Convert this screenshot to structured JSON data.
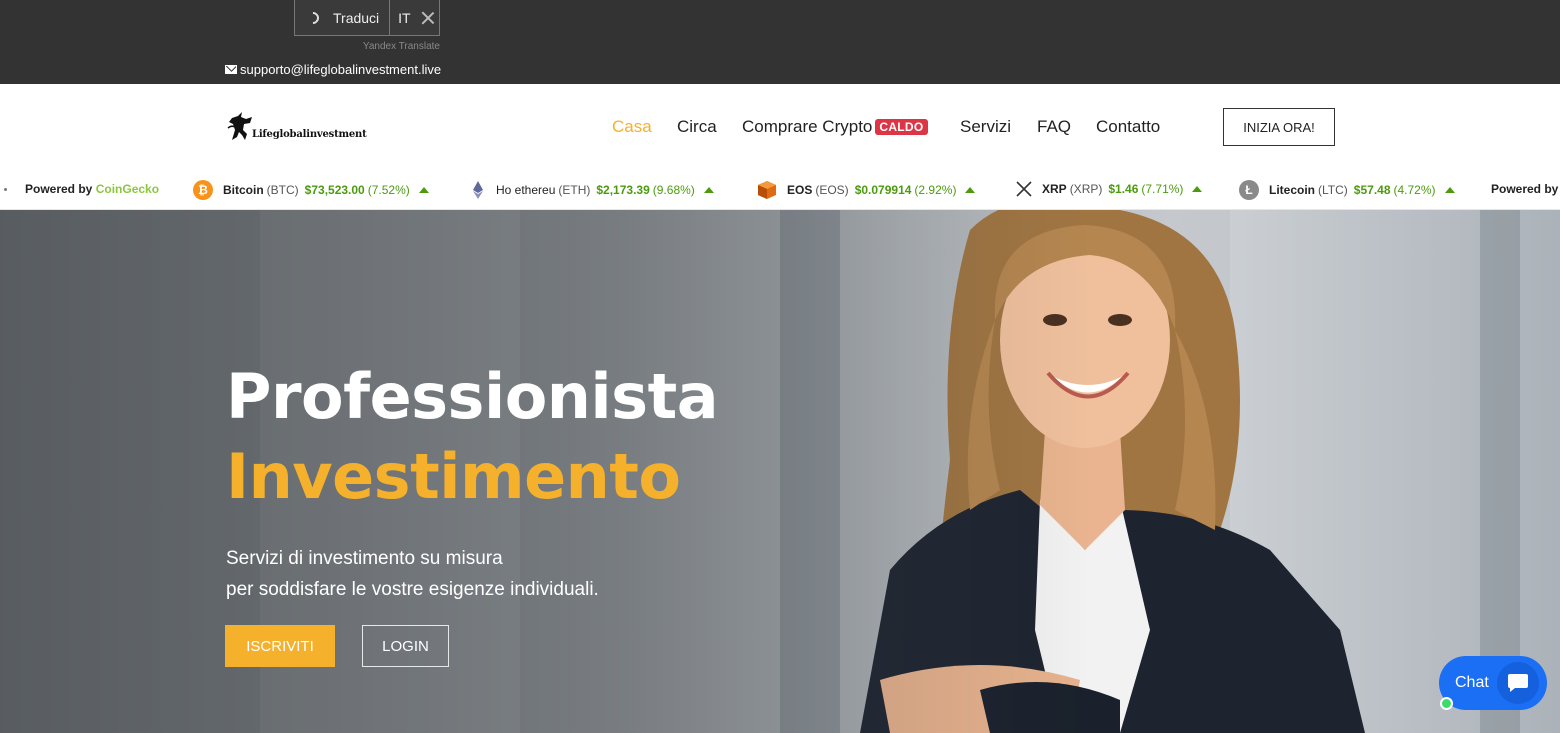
{
  "translate_widget": {
    "label": "Traduci",
    "lang": "IT",
    "provider": "Yandex Translate"
  },
  "topbar": {
    "support_email": "supporto@lifeglobalinvestment.live"
  },
  "brand": {
    "name": "Lifeglobalinvestment"
  },
  "nav": {
    "items": [
      {
        "label": "Casa",
        "active": true
      },
      {
        "label": "Circa"
      },
      {
        "label": "Comprare Crypto",
        "badge": "CALDO"
      },
      {
        "label": "Servizi"
      },
      {
        "label": "FAQ"
      },
      {
        "label": "Contatto"
      }
    ],
    "cta": "INIZIA ORA!"
  },
  "ticker": {
    "powered_prefix": "Powered by",
    "powered_brand": "CoinGecko",
    "coins": [
      {
        "name": "Bitcoin",
        "symbol": "(BTC)",
        "price": "$73,523.00",
        "change": "(7.52%)",
        "icon": "bitcoin-icon"
      },
      {
        "name": "Ho ethereu",
        "symbol": "(ETH)",
        "price": "$2,173.39",
        "change": "(9.68%)",
        "icon": "ethereum-icon"
      },
      {
        "name": "EOS",
        "symbol": "(EOS)",
        "price": "$0.079914",
        "change": "(2.92%)",
        "icon": "eos-icon"
      },
      {
        "name": "XRP",
        "symbol": "(XRP)",
        "price": "$1.46",
        "change": "(7.71%)",
        "icon": "xrp-icon"
      },
      {
        "name": "Litecoin",
        "symbol": "(LTC)",
        "price": "$57.48",
        "change": "(4.72%)",
        "icon": "litecoin-icon"
      }
    ],
    "trailing_powered": "Powered by"
  },
  "hero": {
    "title_line1": "Professionista",
    "title_line2": "Investimento",
    "subtitle_line1": "Servizi di investimento su misura",
    "subtitle_line2": "per soddisfare le vostre esigenze individuali.",
    "signup_label": "ISCRIVITI",
    "login_label": "LOGIN"
  },
  "chat": {
    "label": "Chat"
  },
  "colors": {
    "accent": "#f5b12c",
    "topbar": "#333333",
    "badge": "#dc3545",
    "ticker_green": "#4c9b0f",
    "chat": "#1a6ff5"
  }
}
